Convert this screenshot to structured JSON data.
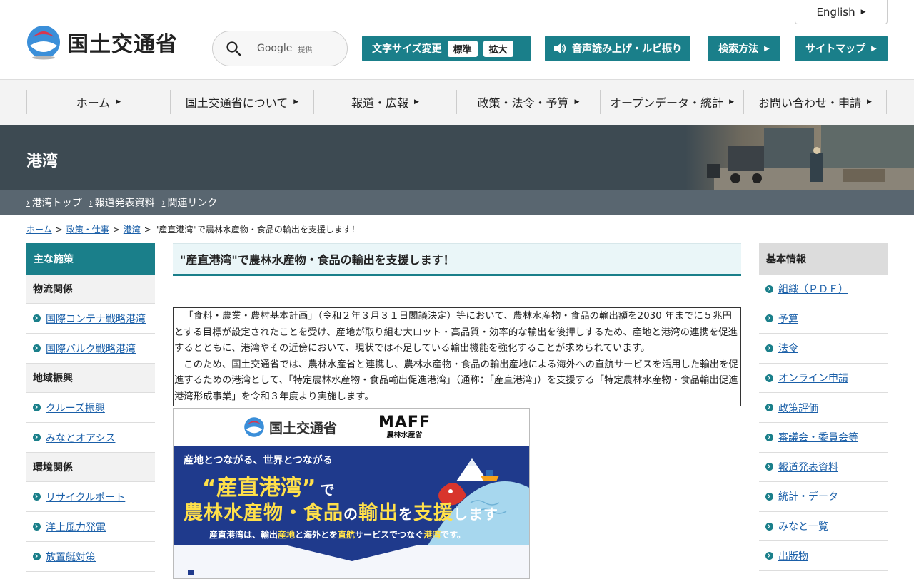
{
  "header": {
    "logo_text": "国土交通省",
    "search": {
      "google_label": "Google",
      "provided_label": "提供"
    },
    "english_label": "English",
    "font_size": {
      "label": "文字サイズ変更",
      "standard": "標準",
      "large": "拡大"
    },
    "voice_label": "音声読み上げ・ルビ振り",
    "search_method_label": "検索方法",
    "sitemap_label": "サイトマップ"
  },
  "gnav": [
    {
      "label": "ホーム"
    },
    {
      "label": "国土交通省について"
    },
    {
      "label": "報道・広報"
    },
    {
      "label": "政策・法令・予算"
    },
    {
      "label": "オープンデータ・統計"
    },
    {
      "label": "お問い合わせ・申請"
    }
  ],
  "banner": {
    "title": "港湾"
  },
  "subnav": [
    {
      "label": "港湾トップ"
    },
    {
      "label": "報道発表資料"
    },
    {
      "label": "関連リンク"
    }
  ],
  "breadcrumb": {
    "items": [
      {
        "label": "ホーム"
      },
      {
        "label": "政策・仕事"
      },
      {
        "label": "港湾"
      }
    ],
    "current": "\"産直港湾\"で農林水産物・食品の輸出を支援します！"
  },
  "left_sidebar": {
    "title": "主な施策",
    "sections": [
      {
        "heading": "物流関係",
        "links": [
          "国際コンテナ戦略港湾",
          "国際バルク戦略港湾"
        ]
      },
      {
        "heading": "地域振興",
        "links": [
          "クルーズ振興",
          "みなとオアシス"
        ]
      },
      {
        "heading": "環境関係",
        "links": [
          "リサイクルポート",
          "洋上風力発電",
          "放置艇対策"
        ]
      }
    ]
  },
  "main": {
    "title": "\"産直港湾\"で農林水産物・食品の輸出を支援します！",
    "paragraphs": [
      "「食料・農業・農村基本計画」（令和２年３月３１日閣議決定）等において、農林水産物・食品の輸出額を2030 年までに５兆円とする目標が設定されたことを受け、産地が取り組む大ロット・高品質・効率的な輸出を後押しするため、産地と港湾の連携を促進するとともに、港湾やその近傍において、現状では不足している輸出機能を強化することが求められています。",
      "このため、国土交通省では、農林水産省と連携し、農林水産物・食品の輸出産地による海外への直航サービスを活用した輸出を促進するための港湾として、「特定農林水産物・食品輸出促進港湾」（通称：「産直港湾」）を支援する「特定農林水産物・食品輸出促進港湾形成事業」を令和３年度より実施します。"
    ],
    "poster": {
      "mlit": "国土交通省",
      "maff": "MAFF",
      "maff_sub": "農林水産省",
      "line1": "産地とつながる、世界とつながる",
      "line2": "“産直港湾”",
      "line2_suffix": "で",
      "line3_a": "農林水産物・食品",
      "line3_b": "の",
      "line3_c": "輸出",
      "line3_d": "を",
      "line3_e": "支援",
      "line3_f": "します",
      "line4_a": "産直港湾は、輸出",
      "line4_b": "産地",
      "line4_c": "と海外とを",
      "line4_d": "直航",
      "line4_e": "サービスでつなぐ",
      "line4_f": "港湾",
      "line4_g": "です。"
    }
  },
  "right_sidebar": {
    "title": "基本情報",
    "links": [
      "組織（ＰＤＦ）",
      "予算",
      "法令",
      "オンライン申請",
      "政策評価",
      "審議会・委員会等",
      "報道発表資料",
      "統計・データ",
      "みなと一覧",
      "出版物"
    ]
  },
  "colors": {
    "accent": "#1a7f8a",
    "banner": "#3d4a52",
    "link": "#1a5fa8",
    "poster_blue": "#1f3a8c",
    "poster_yellow": "#ffe04a"
  }
}
